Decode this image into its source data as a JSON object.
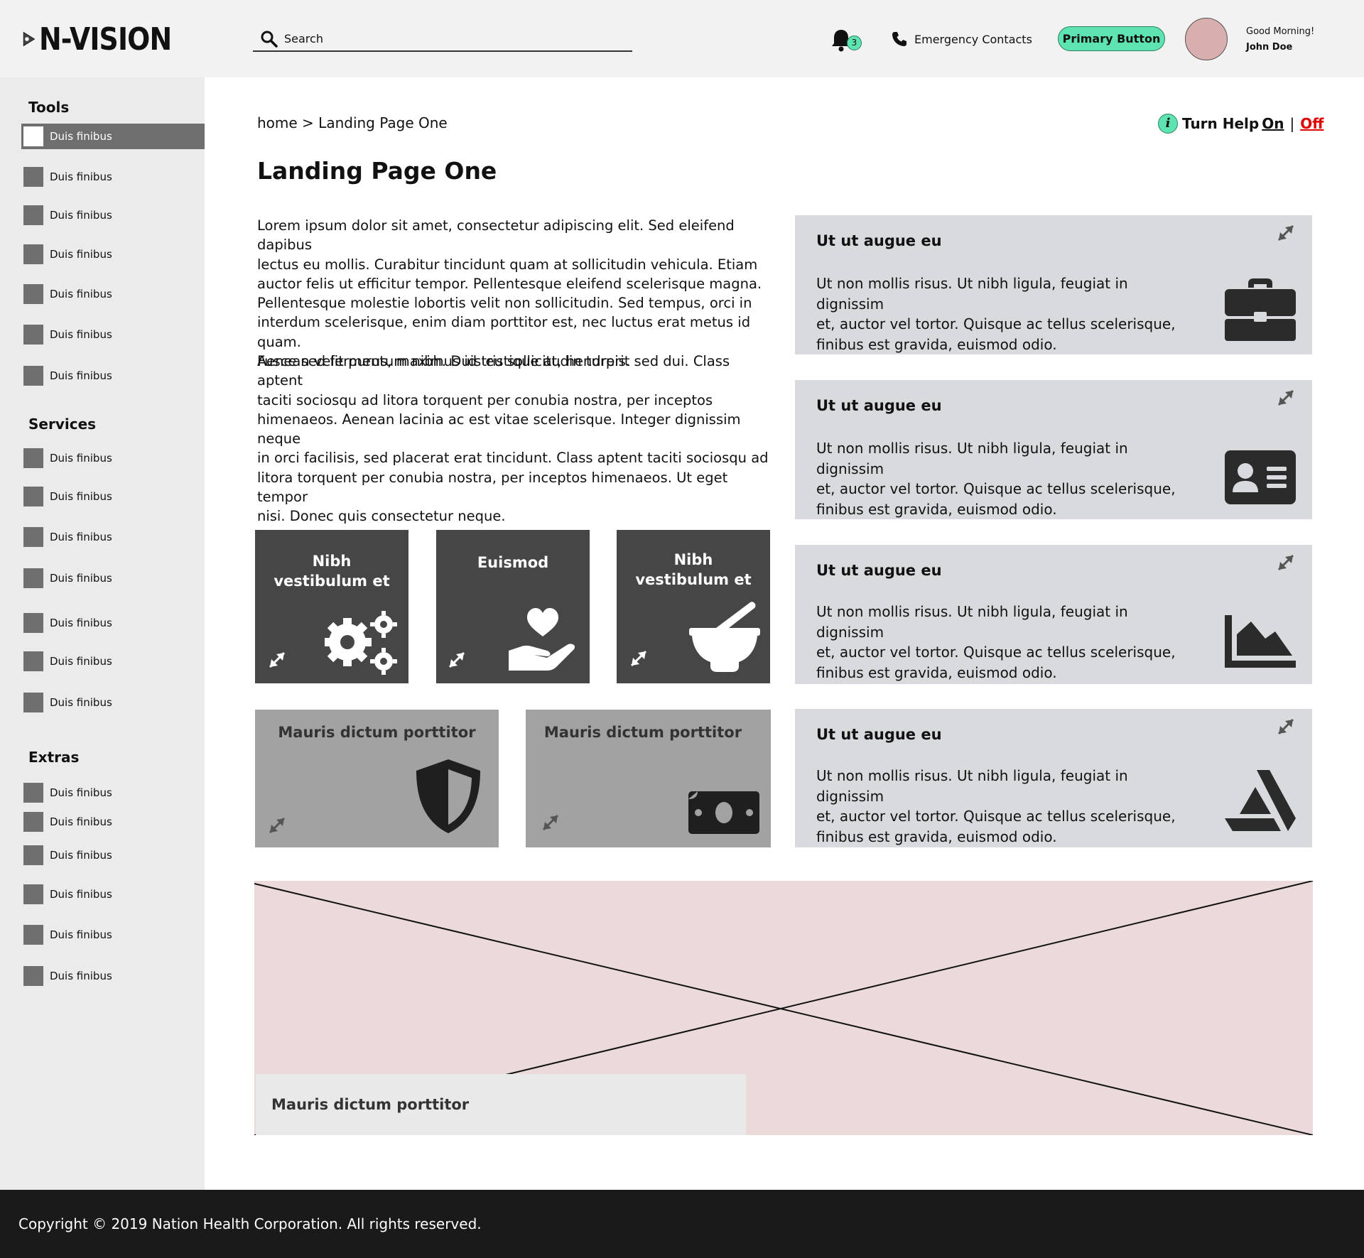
{
  "header": {
    "logo_text": "N-VISION",
    "search_placeholder": "Search",
    "notification_count": "3",
    "emergency_label": "Emergency Contacts",
    "primary_button": "Primary Button",
    "greeting": "Good Morning!",
    "user_name": "John Doe"
  },
  "sidebar": {
    "sections": [
      {
        "title": "Tools",
        "items": [
          "Duis finibus",
          "Duis finibus",
          "Duis finibus",
          "Duis finibus",
          "Duis finibus",
          "Duis finibus",
          "Duis finibus"
        ]
      },
      {
        "title": "Services",
        "items": [
          "Duis finibus",
          "Duis finibus",
          "Duis finibus",
          "Duis finibus",
          "Duis finibus",
          "Duis finibus",
          "Duis finibus"
        ]
      },
      {
        "title": "Extras",
        "items": [
          "Duis finibus",
          "Duis finibus",
          "Duis finibus",
          "Duis finibus",
          "Duis finibus",
          "Duis finibus"
        ]
      }
    ]
  },
  "breadcrumb": "home > Landing Page One",
  "help": {
    "label": "Turn Help",
    "on": "On",
    "separator": "|",
    "off": "Off"
  },
  "page_title": "Landing Page One",
  "paragraphs": [
    [
      "Lorem ipsum dolor sit amet, consectetur adipiscing elit. Sed eleifend dapibus",
      "lectus eu mollis. Curabitur tincidunt quam at sollicitudin vehicula. Etiam",
      "auctor felis ut efficitur tempor. Pellentesque eleifend scelerisque magna.",
      "Pellentesque molestie lobortis velit non sollicitudin. Sed tempus, orci in",
      "interdum scelerisque, enim diam porttitor est, nec luctus erat metus id quam.",
      "Fusce sed fermentum nibh. Duis eu sollicitudin turpis."
    ],
    [
      "Aenean velit purus, maximus id tristique at, hendrerit sed dui. Class aptent",
      "taciti sociosqu ad litora torquent per conubia nostra, per inceptos",
      "himenaeos. Aenean lacinia ac est vitae scelerisque. Integer dignissim neque",
      "in orci facilisis, sed placerat erat tincidunt. Class aptent taciti sociosqu ad",
      "litora torquent per conubia nostra, per inceptos himenaeos. Ut eget tempor",
      "nisi. Donec quis consectetur neque."
    ]
  ],
  "dark_tiles": [
    {
      "lines": [
        "Nibh",
        "vestibulum et"
      ],
      "icon": "gears-icon"
    },
    {
      "lines": [
        "Euismod"
      ],
      "icon": "hand-heart-icon"
    },
    {
      "lines": [
        "Nibh",
        "vestibulum et"
      ],
      "icon": "mortar-pestle-icon"
    }
  ],
  "grey_tiles": [
    {
      "title": "Mauris dictum porttitor",
      "icon": "shield-icon"
    },
    {
      "title": "Mauris dictum porttitor",
      "icon": "money-bill-icon"
    }
  ],
  "cards": [
    {
      "title": "Ut ut augue eu",
      "body": [
        "Ut non mollis risus. Ut nibh ligula, feugiat in dignissim",
        "et, auctor vel tortor. Quisque ac tellus scelerisque,",
        "finibus est gravida, euismod odio."
      ],
      "icon": "briefcase-icon"
    },
    {
      "title": "Ut ut augue eu",
      "body": [
        "Ut non mollis risus. Ut nibh ligula, feugiat in dignissim",
        "et, auctor vel tortor. Quisque ac tellus scelerisque,",
        "finibus est gravida, euismod odio."
      ],
      "icon": "id-card-icon"
    },
    {
      "title": "Ut ut augue eu",
      "body": [
        "Ut non mollis risus. Ut nibh ligula, feugiat in dignissim",
        "et, auctor vel tortor. Quisque ac tellus scelerisque,",
        "finibus est gravida, euismod odio."
      ],
      "icon": "area-chart-icon"
    },
    {
      "title": "Ut ut augue eu",
      "body": [
        "Ut non mollis risus. Ut nibh ligula, feugiat in dignissim",
        "et, auctor vel tortor. Quisque ac tellus scelerisque,",
        "finibus est gravida, euismod odio."
      ],
      "icon": "artstation-icon"
    }
  ],
  "banner": {
    "caption": "Mauris dictum porttitor",
    "icon": "image-placeholder"
  },
  "footer": {
    "copyright": "Copyright © 2019  Nation Health Corporation. All rights reserved."
  },
  "colors": {
    "accent": "#5de4b0",
    "off": "#e00000",
    "dark_tile": "#464646",
    "grey_tile": "#a2a2a2",
    "card": "#d9dadd",
    "banner": "#ecdadb",
    "footer": "#1a1a1a"
  }
}
